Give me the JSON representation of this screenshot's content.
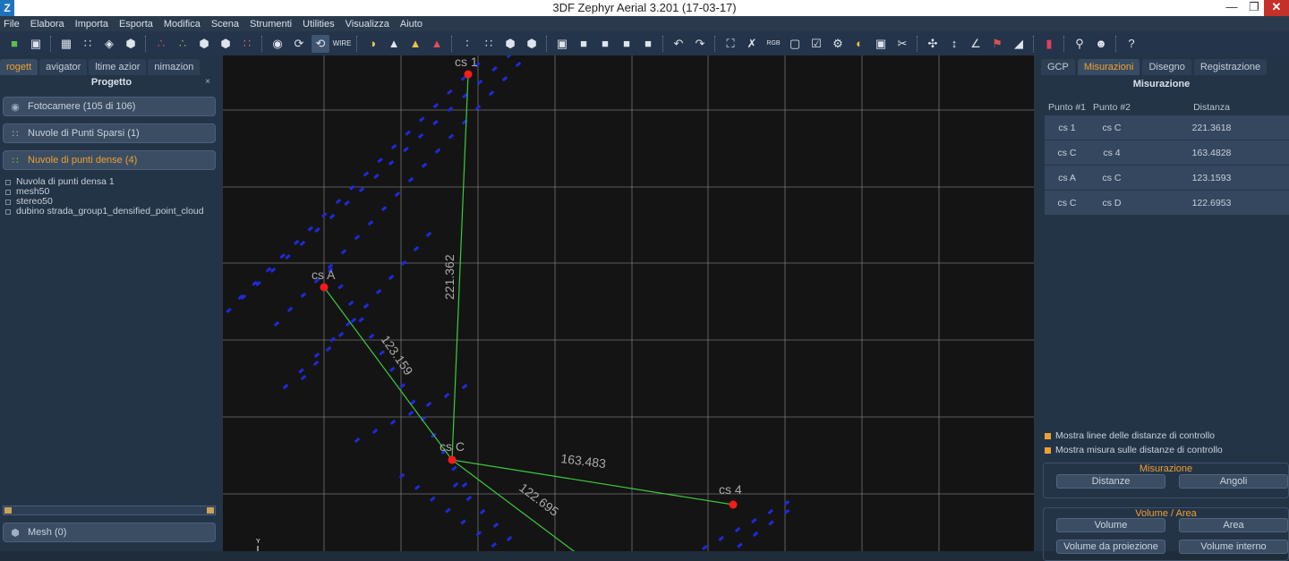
{
  "window": {
    "title": "3DF Zephyr Aerial 3.201 (17-03-17)",
    "app_icon": "Z"
  },
  "menu": [
    "File",
    "Elabora",
    "Importa",
    "Esporta",
    "Modifica",
    "Scena",
    "Strumenti",
    "Utilities",
    "Visualizza",
    "Aiuto"
  ],
  "left_panel": {
    "tabs": [
      "rogett",
      "avigator",
      "ltime azior",
      "nimazion"
    ],
    "title": "Progetto",
    "close": "×",
    "sections": {
      "cameras": "Fotocamere (105 di 106)",
      "sparse": "Nuvole di Punti Sparsi (1)",
      "dense": "Nuvole di punti dense (4)",
      "mesh": "Mesh (0)"
    },
    "tree": [
      "Nuvola di punti densa 1",
      "mesh50",
      "stereo50",
      "dubino strada_group1_densified_point_cloud"
    ]
  },
  "viewport": {
    "labels": {
      "cs1": "cs 1",
      "csA": "cs A",
      "csC": "cs C",
      "cs4": "cs 4"
    },
    "distances": {
      "d1": "221.362",
      "d2": "123.159",
      "d3": "163.483",
      "d4": "122.695"
    },
    "axis_y": "Y",
    "colors": {
      "background": "#141414",
      "grid": "#8a8a8a",
      "point": "#1e2bd8",
      "marker": "#ff1a1a",
      "line": "#3ccc3c"
    }
  },
  "right_panel": {
    "tabs": [
      "GCP",
      "Misurazioni",
      "Disegno",
      "Registrazione"
    ],
    "title": "Misurazione",
    "table": {
      "headers": [
        "Punto #1",
        "Punto #2",
        "Distanza"
      ],
      "rows": [
        [
          "cs 1",
          "cs C",
          "221.3618"
        ],
        [
          "cs C",
          "cs 4",
          "163.4828"
        ],
        [
          "cs A",
          "cs C",
          "123.1593"
        ],
        [
          "cs C",
          "cs D",
          "122.6953"
        ]
      ]
    },
    "checkboxes": [
      "Mostra linee delle distanze di controllo",
      "Mostra misura sulle distanze di controllo"
    ],
    "measure_group": {
      "title": "Misurazione",
      "btn_distances": "Distanze",
      "btn_angles": "Angoli"
    },
    "volume_group": {
      "title": "Volume / Area",
      "btn_volume": "Volume",
      "btn_area": "Area",
      "btn_projection": "Volume da proiezione",
      "btn_internal": "Volume interno"
    }
  },
  "accent_color": "#f0a030"
}
